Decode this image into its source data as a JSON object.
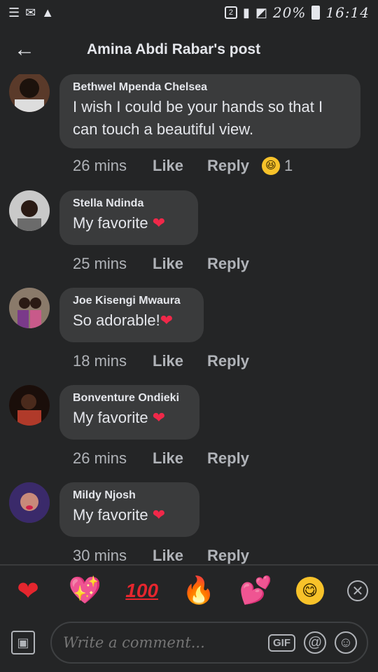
{
  "status_bar": {
    "left_icons": [
      "menu-icon",
      "message-icon",
      "warning-icon"
    ],
    "sim_label": "2",
    "battery": "20%",
    "time": "16:14"
  },
  "header": {
    "back_icon": "arrow-left-icon",
    "title": "Amina Abdi Rabar's post"
  },
  "comments": [
    {
      "author": "Bethwel Mpenda Chelsea",
      "text": "I wish I could be your hands so that I can touch a beautiful  view.",
      "time": "26 mins",
      "like": "Like",
      "reply": "Reply",
      "reaction_icon": "grinning-squint-emoji",
      "reaction_count": "1"
    },
    {
      "author": "Stella Ndinda",
      "text": "My favorite",
      "emoji": "❤",
      "time": "25 mins",
      "like": "Like",
      "reply": "Reply"
    },
    {
      "author": "Joe Kisengi Mwaura",
      "text": "So adorable!",
      "emoji": "❤",
      "time": "18 mins",
      "like": "Like",
      "reply": "Reply"
    },
    {
      "author": "Bonventure Ondieki",
      "text": "My favorite",
      "emoji": "❤",
      "time": "26 mins",
      "like": "Like",
      "reply": "Reply"
    },
    {
      "author": "Mildy Njosh",
      "text": "My favorite",
      "emoji": "❤",
      "time": "30 mins",
      "like": "Like",
      "reply": "Reply"
    }
  ],
  "quick_emojis": [
    "red-heart-emoji",
    "sparkling-heart-emoji",
    "hundred-points-emoji",
    "fire-emoji",
    "two-hearts-emoji",
    "yum-face-emoji",
    "close-icon"
  ],
  "composer": {
    "placeholder": "Write a comment...",
    "gif_label": "GIF",
    "mention_icon": "at-icon",
    "emoji_icon": "smiley-icon",
    "photo_icon": "photo-icon"
  },
  "colors": {
    "background": "#242526",
    "bubble": "#3a3b3c",
    "text": "#e4e6eb",
    "muted": "#b0b3b8",
    "heart": "#f02849"
  }
}
